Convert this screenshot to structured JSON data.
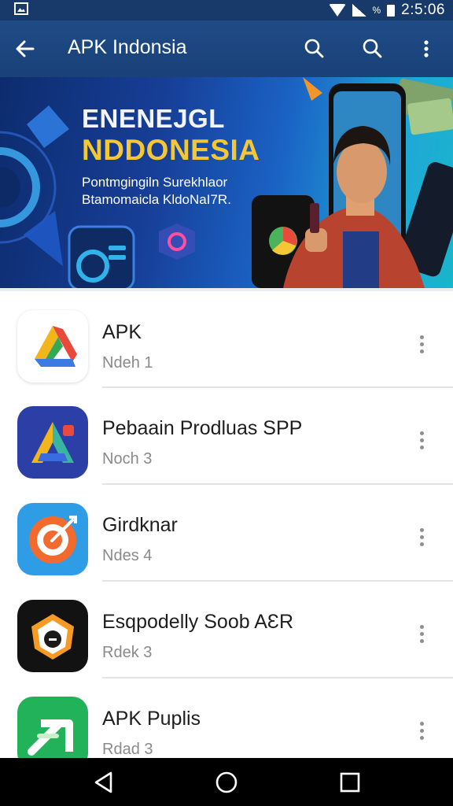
{
  "status_bar": {
    "time": "2:5:06",
    "battery_label": "%"
  },
  "app_bar": {
    "title": "APK Indonsia"
  },
  "banner": {
    "headline_1": "ENENEJGL",
    "headline_2": "NDDONESIA",
    "subtitle_1": "Pontmgingiln Surekhlaor",
    "subtitle_2": "Btamomaicla KldoNaI7R.",
    "colors": {
      "headline_accent": "#f6c735"
    }
  },
  "apps": [
    {
      "name": "APK",
      "sub": "Ndeh 1",
      "icon": "triangle-drive-logo-icon"
    },
    {
      "name": "Pebaain Prodluas SPP",
      "sub": "Noch 3",
      "icon": "triangle-a-logo-icon"
    },
    {
      "name": "Girdknar",
      "sub": "Ndes 4",
      "icon": "target-arrow-logo-icon"
    },
    {
      "name": "Esqpodelly Soob AƐR",
      "sub": "Rdek 3",
      "icon": "shield-lock-logo-icon"
    },
    {
      "name": "APK Puplis",
      "sub": "Rdad 3",
      "icon": "green-arrow-logo-icon"
    }
  ]
}
